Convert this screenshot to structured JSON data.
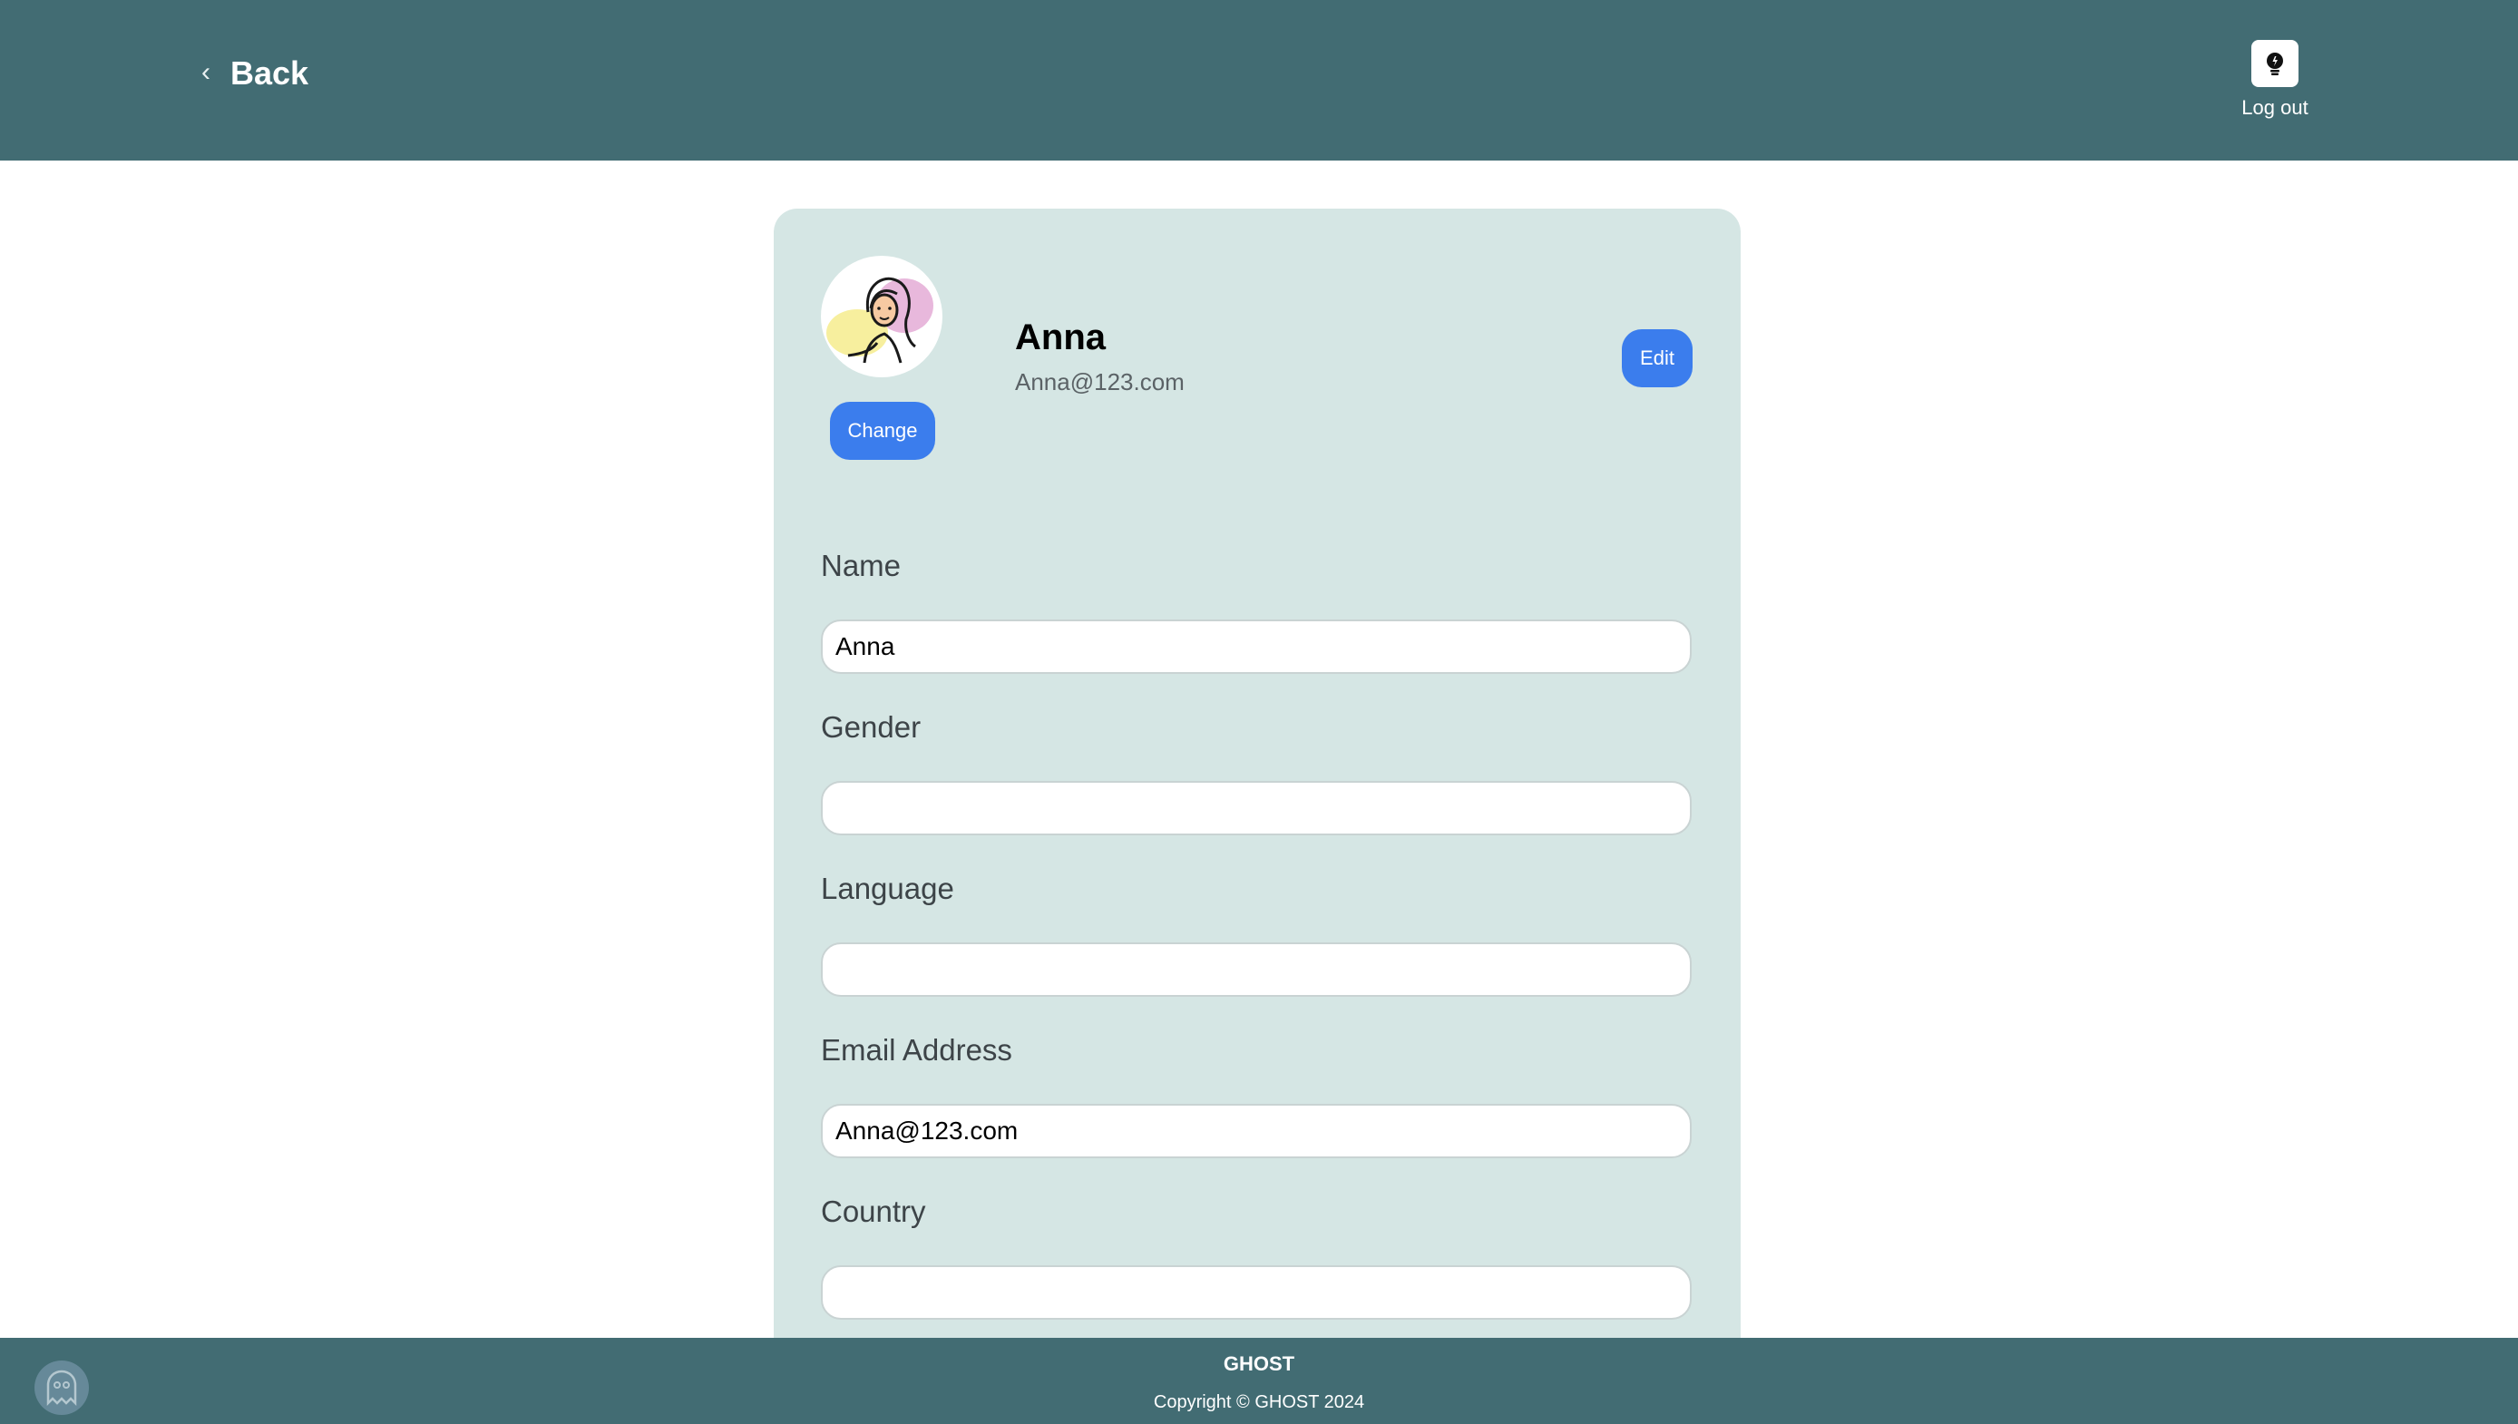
{
  "header": {
    "back_label": "Back",
    "logout_label": "Log out",
    "logout_icon": "power-bulb-icon"
  },
  "profile": {
    "name": "Anna",
    "email": "Anna@123.com",
    "change_label": "Change",
    "edit_label": "Edit",
    "avatar_icon": "woman-illustration-avatar"
  },
  "fields": {
    "name": {
      "label": "Name",
      "value": "Anna"
    },
    "gender": {
      "label": "Gender",
      "value": ""
    },
    "language": {
      "label": "Language",
      "value": ""
    },
    "email": {
      "label": "Email Address",
      "value": "Anna@123.com"
    },
    "country": {
      "label": "Country",
      "value": ""
    }
  },
  "footer": {
    "brand": "GHOST",
    "copyright": "Copyright © GHOST 2024"
  },
  "colors": {
    "header_bg": "#426c73",
    "card_bg": "#d5e6e4",
    "accent_blue": "#3b7ded"
  }
}
